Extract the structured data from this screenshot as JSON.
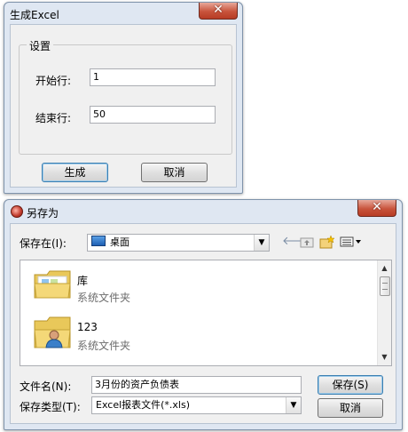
{
  "dialog1": {
    "title": "生成Excel",
    "close_symbol": "✕",
    "group_label": "设置",
    "start_label": "开始行:",
    "start_value": "1",
    "end_label": "结束行:",
    "end_value": "50",
    "generate_label": "生成",
    "cancel_label": "取消"
  },
  "dialog2": {
    "title": "另存为",
    "close_symbol": "✕",
    "save_in_label": "保存在(I):",
    "save_in_value": "桌面",
    "files": [
      {
        "name": "库",
        "type": "系统文件夹"
      },
      {
        "name": "123",
        "type": "系统文件夹"
      }
    ],
    "filename_label": "文件名(N):",
    "filename_value": "3月份的资产负债表",
    "filetype_label": "保存类型(T):",
    "filetype_value": "Excel报表文件(*.xls)",
    "save_label": "保存(S)",
    "cancel_label": "取消"
  },
  "icons": {
    "back": "back-arrow-icon",
    "up_folder": "up-folder-icon",
    "new_folder": "new-folder-icon",
    "view_menu": "view-menu-icon",
    "desktop": "desktop-icon"
  }
}
